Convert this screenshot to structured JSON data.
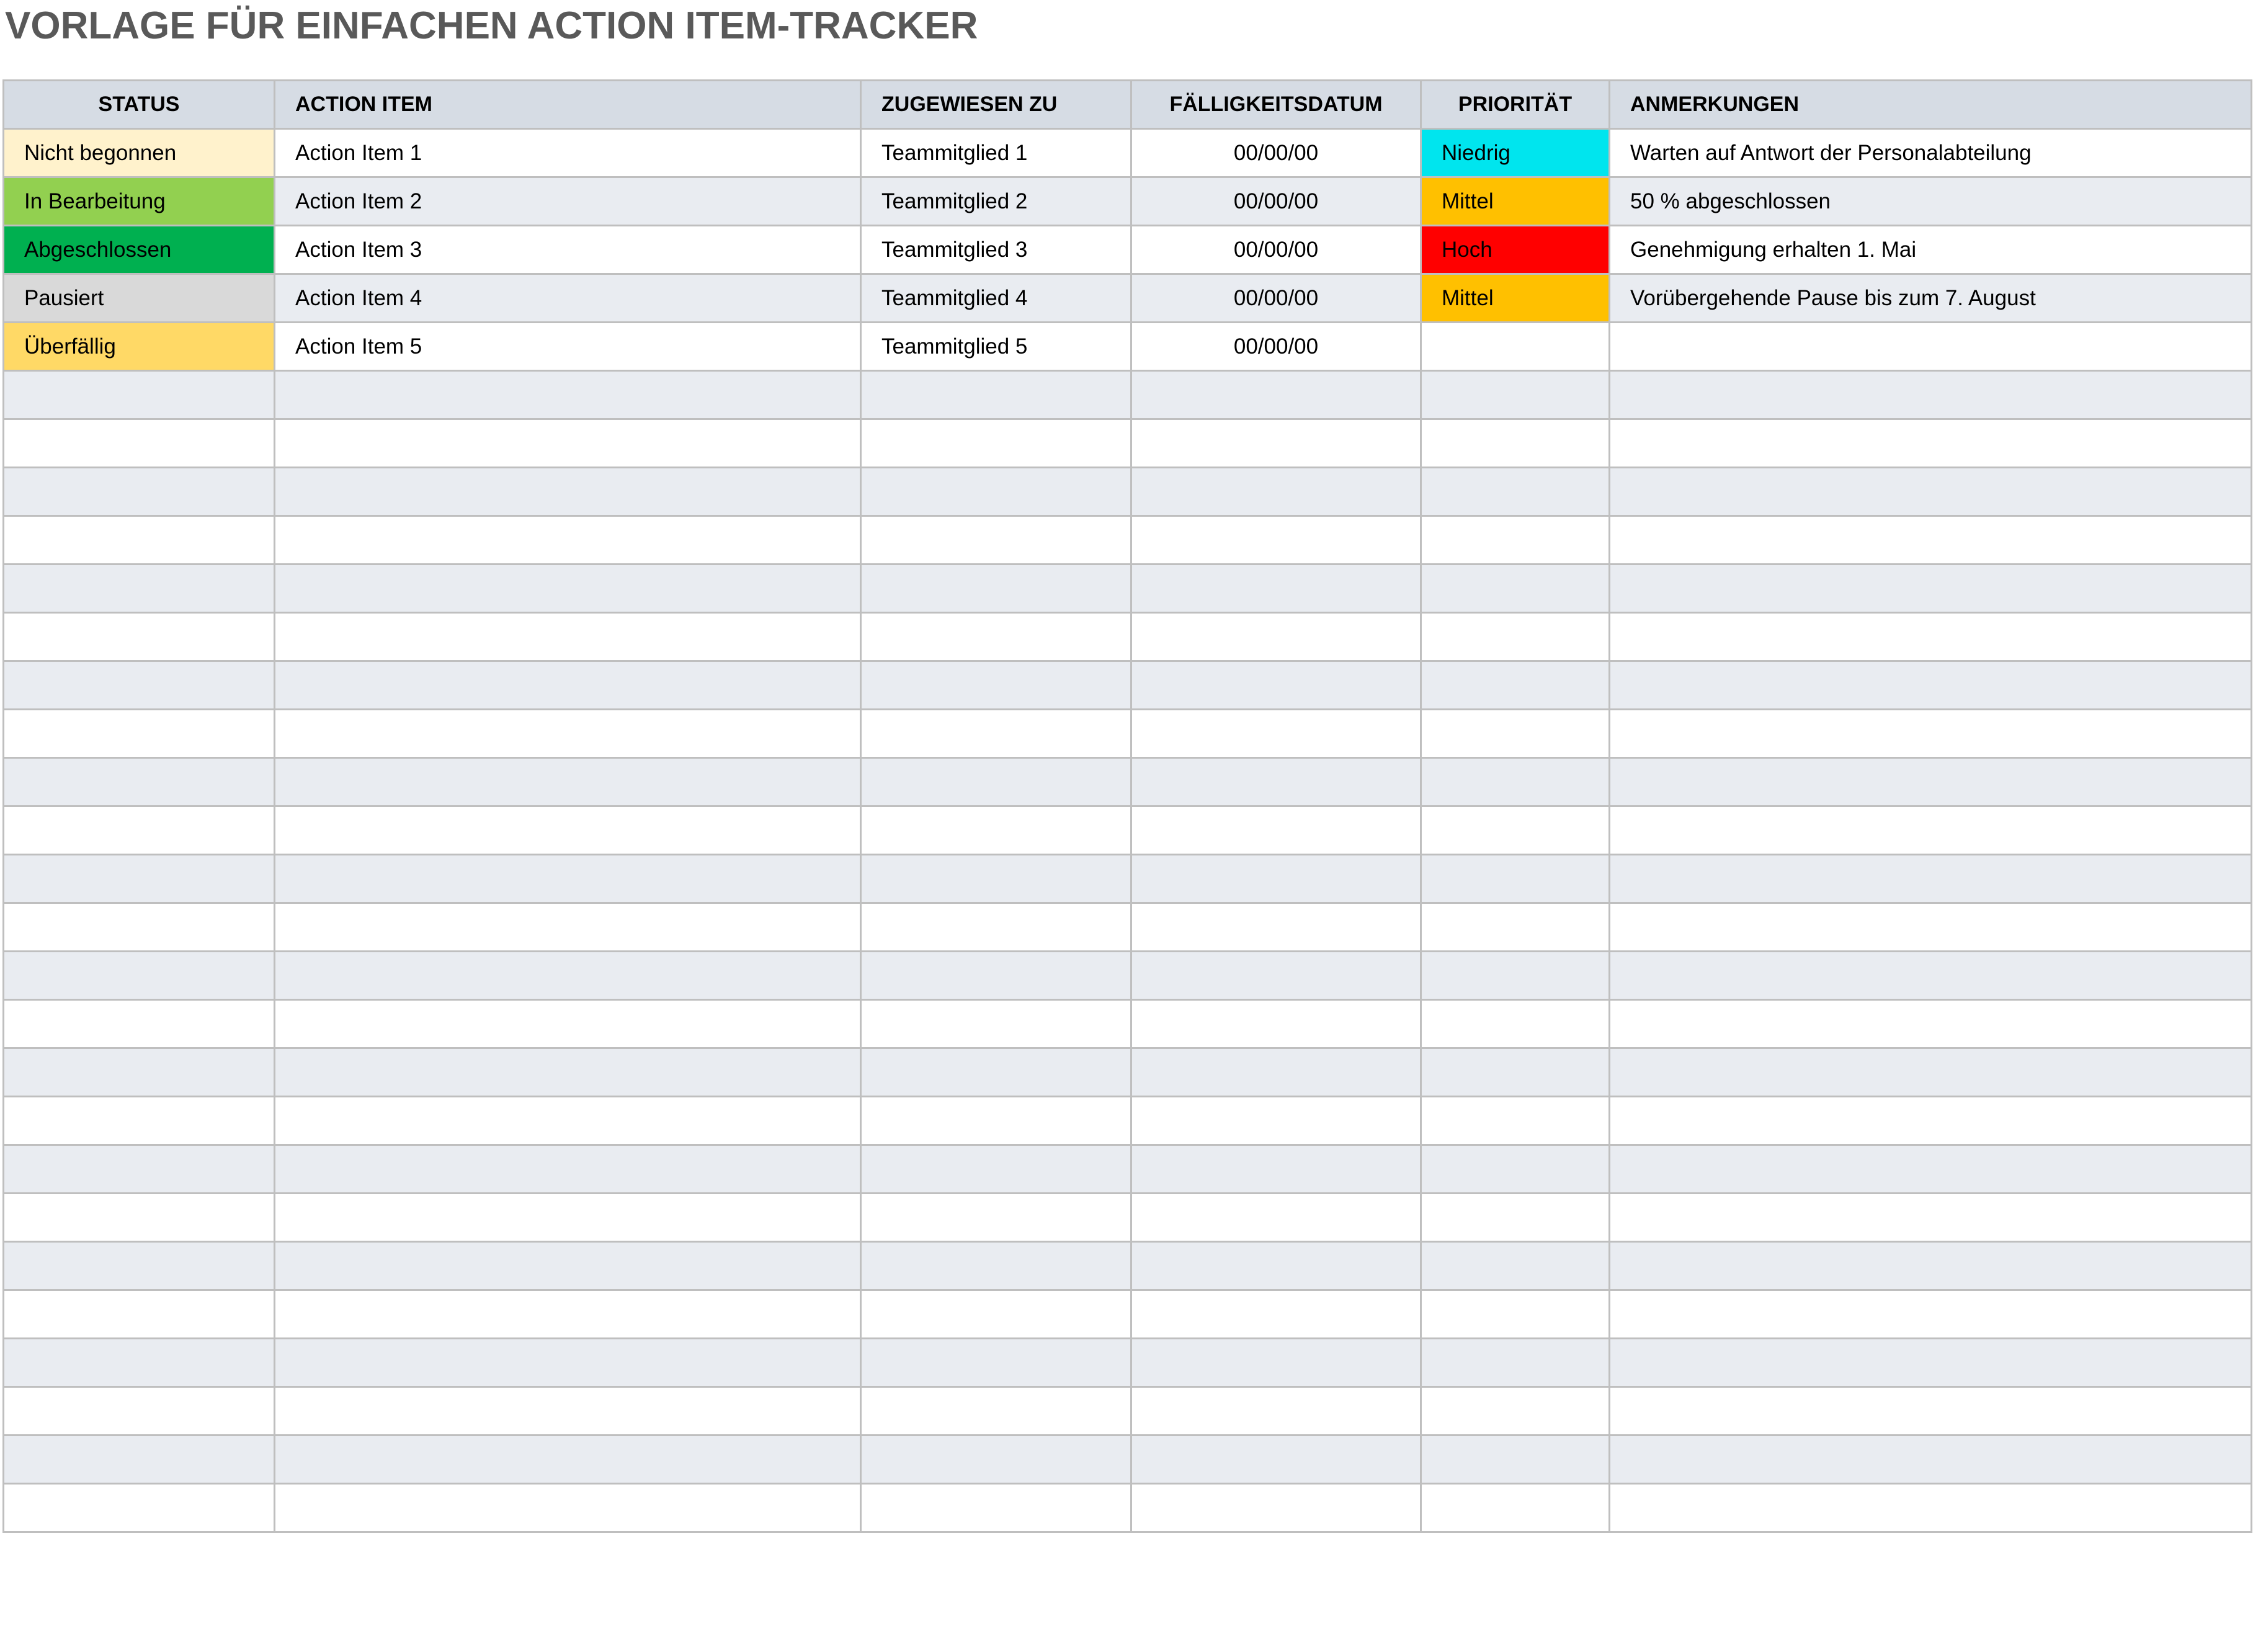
{
  "title": "VORLAGE FÜR EINFACHEN ACTION ITEM-TRACKER",
  "colors": {
    "header_bg": "#d6dce4",
    "row_alt_bg": "#e9ecf1",
    "title_color": "#595959",
    "grid_line": "#bfbfbf"
  },
  "table": {
    "headers": [
      "STATUS",
      "ACTION ITEM",
      "ZUGEWIESEN ZU",
      "FÄLLIGKEITSDATUM",
      "PRIORITÄT",
      "ANMERKUNGEN"
    ],
    "rows": [
      {
        "status": "Nicht begonnen",
        "status_color": "#fff2cc",
        "item": "Action Item 1",
        "assignee": "Teammitglied 1",
        "due": "00/00/00",
        "priority": "Niedrig",
        "priority_color": "#00e5ee",
        "notes": "Warten auf Antwort der Personalabteilung"
      },
      {
        "status": "In Bearbeitung",
        "status_color": "#92d050",
        "item": "Action Item 2",
        "assignee": "Teammitglied 2",
        "due": "00/00/00",
        "priority": "Mittel",
        "priority_color": "#ffc000",
        "notes": "50 % abgeschlossen"
      },
      {
        "status": "Abgeschlossen",
        "status_color": "#00b050",
        "item": "Action Item 3",
        "assignee": "Teammitglied 3",
        "due": "00/00/00",
        "priority": "Hoch",
        "priority_color": "#ff0000",
        "notes": "Genehmigung erhalten 1. Mai"
      },
      {
        "status": "Pausiert",
        "status_color": "#d9d9d9",
        "item": "Action Item 4",
        "assignee": "Teammitglied 4",
        "due": "00/00/00",
        "priority": "Mittel",
        "priority_color": "#ffc000",
        "notes": "Vorübergehende Pause bis zum 7. August"
      },
      {
        "status": "Überfällig",
        "status_color": "#ffd966",
        "item": "Action Item 5",
        "assignee": "Teammitglied 5",
        "due": "00/00/00",
        "priority": "",
        "priority_color": "",
        "notes": ""
      }
    ],
    "empty_row_count": 24
  }
}
